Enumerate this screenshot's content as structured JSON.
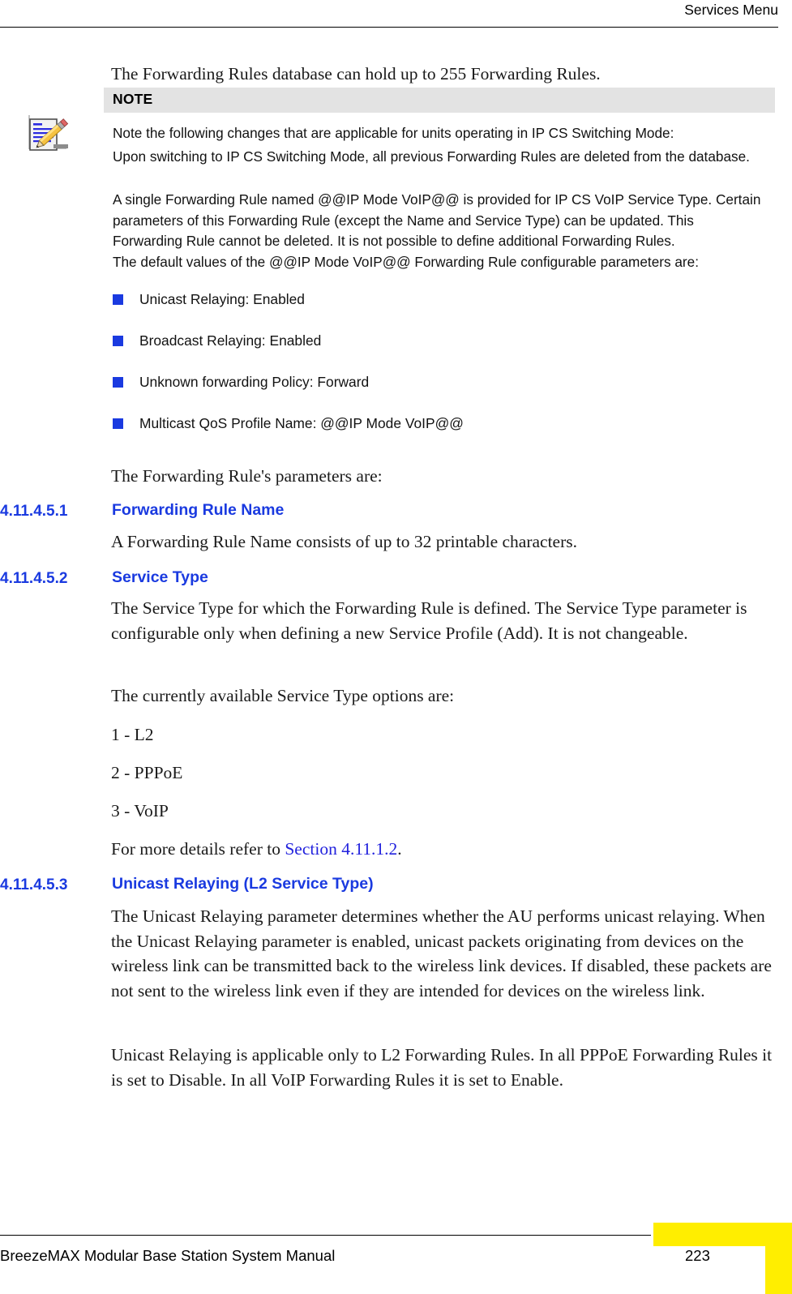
{
  "header": {
    "title": "Services Menu"
  },
  "intro": {
    "paragraph": "The Forwarding Rules database can hold up to 255 Forwarding Rules."
  },
  "note": {
    "icon": "note-pencil-icon",
    "label": "NOTE",
    "paragraphs": [
      "Note the following changes that are applicable for units operating in IP CS Switching Mode:",
      "Upon switching to IP CS Switching Mode, all previous Forwarding Rules are deleted from the database.",
      "A single Forwarding Rule named @@IP Mode VoIP@@ is provided for IP CS VoIP Service Type. Certain parameters of this Forwarding Rule (except the Name and Service Type) can be updated. This Forwarding Rule cannot be deleted. It is not possible to define additional Forwarding Rules.",
      "The default values of the @@IP Mode VoIP@@ Forwarding Rule configurable parameters are:"
    ],
    "bullets": [
      "Unicast Relaying: Enabled",
      "Broadcast Relaying: Enabled",
      "Unknown forwarding Policy: Forward",
      "Multicast QoS Profile Name: @@IP Mode VoIP@@"
    ]
  },
  "lead_in": {
    "paragraph": "The Forwarding Rule's parameters are:"
  },
  "sections": [
    {
      "number": "4.11.4.5.1",
      "title": "Forwarding Rule Name",
      "body": "A Forwarding Rule Name consists of up to 32 printable characters."
    },
    {
      "number": "4.11.4.5.2",
      "title": "Service Type",
      "body": "The Service Type for which the Forwarding Rule is defined. The Service Type parameter is configurable only when defining a new Service Profile (Add). It is not changeable.",
      "body2": "The currently available Service Type options are:",
      "options": [
        "1 - L2",
        "2 - PPPoE",
        "3 - VoIP"
      ],
      "ref_prefix": "For more details refer to ",
      "ref_link": "Section 4.11.1.2",
      "ref_suffix": "."
    },
    {
      "number": "4.11.4.5.3",
      "title": "Unicast Relaying (L2 Service Type)",
      "body": "The Unicast Relaying parameter determines whether the AU performs unicast relaying. When the Unicast Relaying parameter is enabled, unicast packets originating from devices on the wireless link can be transmitted back to the wireless link devices. If disabled, these packets are not sent to the wireless link even if they are intended for devices on the wireless link.",
      "body2": "Unicast Relaying is applicable only to L2 Forwarding Rules. In all PPPoE Forwarding Rules it is set to Disable. In all VoIP Forwarding Rules it is set to Enable."
    }
  ],
  "footer": {
    "manual_title": "BreezeMAX Modular Base Station System Manual",
    "page_number": "223"
  },
  "colors": {
    "heading_blue": "#1a3ae0",
    "link_blue": "#2222dd",
    "note_bar_gray": "#e3e3e3",
    "tab_yellow": "#ffee00"
  }
}
